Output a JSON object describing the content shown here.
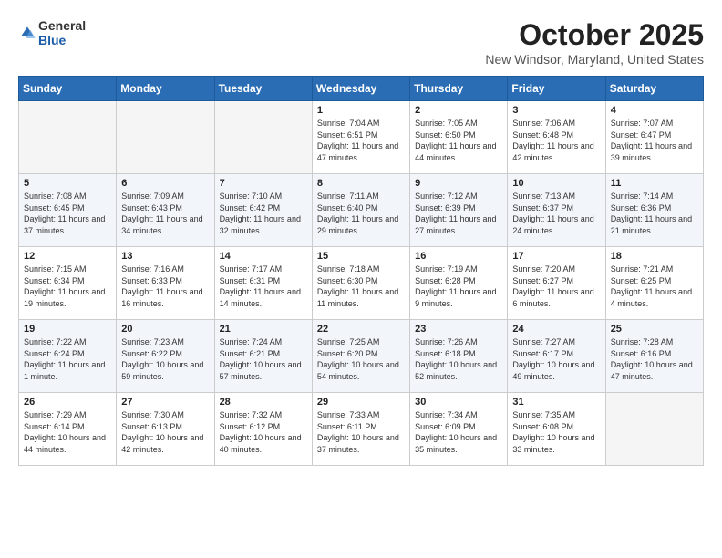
{
  "header": {
    "logo": {
      "general": "General",
      "blue": "Blue"
    },
    "title": "October 2025",
    "location": "New Windsor, Maryland, United States"
  },
  "weekdays": [
    "Sunday",
    "Monday",
    "Tuesday",
    "Wednesday",
    "Thursday",
    "Friday",
    "Saturday"
  ],
  "weeks": [
    [
      {
        "day": "",
        "info": ""
      },
      {
        "day": "",
        "info": ""
      },
      {
        "day": "",
        "info": ""
      },
      {
        "day": "1",
        "info": "Sunrise: 7:04 AM\nSunset: 6:51 PM\nDaylight: 11 hours and 47 minutes."
      },
      {
        "day": "2",
        "info": "Sunrise: 7:05 AM\nSunset: 6:50 PM\nDaylight: 11 hours and 44 minutes."
      },
      {
        "day": "3",
        "info": "Sunrise: 7:06 AM\nSunset: 6:48 PM\nDaylight: 11 hours and 42 minutes."
      },
      {
        "day": "4",
        "info": "Sunrise: 7:07 AM\nSunset: 6:47 PM\nDaylight: 11 hours and 39 minutes."
      }
    ],
    [
      {
        "day": "5",
        "info": "Sunrise: 7:08 AM\nSunset: 6:45 PM\nDaylight: 11 hours and 37 minutes."
      },
      {
        "day": "6",
        "info": "Sunrise: 7:09 AM\nSunset: 6:43 PM\nDaylight: 11 hours and 34 minutes."
      },
      {
        "day": "7",
        "info": "Sunrise: 7:10 AM\nSunset: 6:42 PM\nDaylight: 11 hours and 32 minutes."
      },
      {
        "day": "8",
        "info": "Sunrise: 7:11 AM\nSunset: 6:40 PM\nDaylight: 11 hours and 29 minutes."
      },
      {
        "day": "9",
        "info": "Sunrise: 7:12 AM\nSunset: 6:39 PM\nDaylight: 11 hours and 27 minutes."
      },
      {
        "day": "10",
        "info": "Sunrise: 7:13 AM\nSunset: 6:37 PM\nDaylight: 11 hours and 24 minutes."
      },
      {
        "day": "11",
        "info": "Sunrise: 7:14 AM\nSunset: 6:36 PM\nDaylight: 11 hours and 21 minutes."
      }
    ],
    [
      {
        "day": "12",
        "info": "Sunrise: 7:15 AM\nSunset: 6:34 PM\nDaylight: 11 hours and 19 minutes."
      },
      {
        "day": "13",
        "info": "Sunrise: 7:16 AM\nSunset: 6:33 PM\nDaylight: 11 hours and 16 minutes."
      },
      {
        "day": "14",
        "info": "Sunrise: 7:17 AM\nSunset: 6:31 PM\nDaylight: 11 hours and 14 minutes."
      },
      {
        "day": "15",
        "info": "Sunrise: 7:18 AM\nSunset: 6:30 PM\nDaylight: 11 hours and 11 minutes."
      },
      {
        "day": "16",
        "info": "Sunrise: 7:19 AM\nSunset: 6:28 PM\nDaylight: 11 hours and 9 minutes."
      },
      {
        "day": "17",
        "info": "Sunrise: 7:20 AM\nSunset: 6:27 PM\nDaylight: 11 hours and 6 minutes."
      },
      {
        "day": "18",
        "info": "Sunrise: 7:21 AM\nSunset: 6:25 PM\nDaylight: 11 hours and 4 minutes."
      }
    ],
    [
      {
        "day": "19",
        "info": "Sunrise: 7:22 AM\nSunset: 6:24 PM\nDaylight: 11 hours and 1 minute."
      },
      {
        "day": "20",
        "info": "Sunrise: 7:23 AM\nSunset: 6:22 PM\nDaylight: 10 hours and 59 minutes."
      },
      {
        "day": "21",
        "info": "Sunrise: 7:24 AM\nSunset: 6:21 PM\nDaylight: 10 hours and 57 minutes."
      },
      {
        "day": "22",
        "info": "Sunrise: 7:25 AM\nSunset: 6:20 PM\nDaylight: 10 hours and 54 minutes."
      },
      {
        "day": "23",
        "info": "Sunrise: 7:26 AM\nSunset: 6:18 PM\nDaylight: 10 hours and 52 minutes."
      },
      {
        "day": "24",
        "info": "Sunrise: 7:27 AM\nSunset: 6:17 PM\nDaylight: 10 hours and 49 minutes."
      },
      {
        "day": "25",
        "info": "Sunrise: 7:28 AM\nSunset: 6:16 PM\nDaylight: 10 hours and 47 minutes."
      }
    ],
    [
      {
        "day": "26",
        "info": "Sunrise: 7:29 AM\nSunset: 6:14 PM\nDaylight: 10 hours and 44 minutes."
      },
      {
        "day": "27",
        "info": "Sunrise: 7:30 AM\nSunset: 6:13 PM\nDaylight: 10 hours and 42 minutes."
      },
      {
        "day": "28",
        "info": "Sunrise: 7:32 AM\nSunset: 6:12 PM\nDaylight: 10 hours and 40 minutes."
      },
      {
        "day": "29",
        "info": "Sunrise: 7:33 AM\nSunset: 6:11 PM\nDaylight: 10 hours and 37 minutes."
      },
      {
        "day": "30",
        "info": "Sunrise: 7:34 AM\nSunset: 6:09 PM\nDaylight: 10 hours and 35 minutes."
      },
      {
        "day": "31",
        "info": "Sunrise: 7:35 AM\nSunset: 6:08 PM\nDaylight: 10 hours and 33 minutes."
      },
      {
        "day": "",
        "info": ""
      }
    ]
  ]
}
